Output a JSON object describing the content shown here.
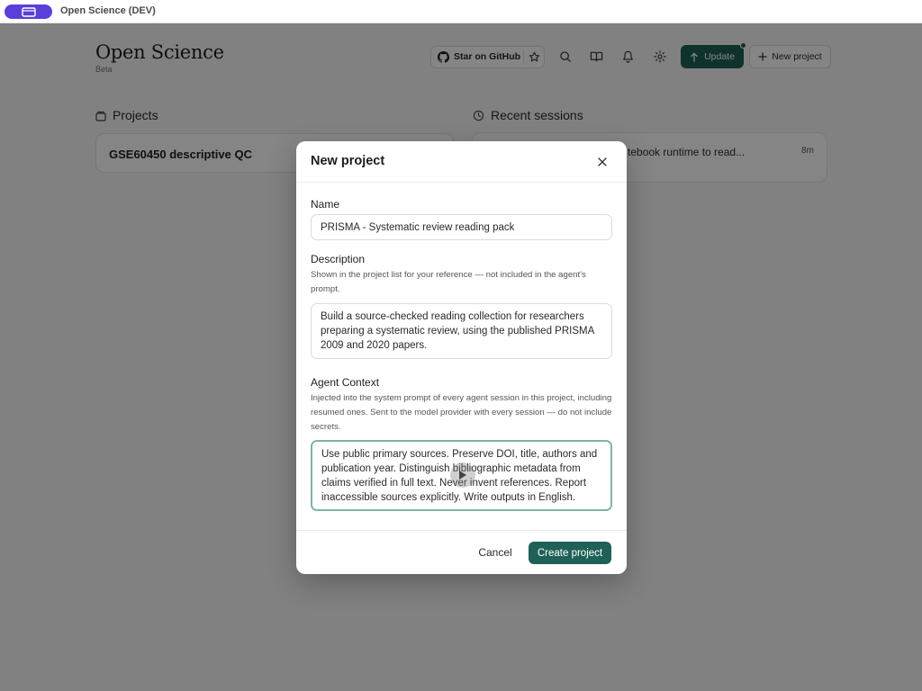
{
  "titlebar": {
    "title": "Open Science (DEV)",
    "app_icon": "window-icon",
    "accent": "#5b3fd9"
  },
  "header": {
    "brand": "Open Science",
    "tag": "Beta",
    "github_label": "Star on GitHub",
    "update_label": "Update",
    "new_project_label": "New project",
    "icons": [
      "github-icon",
      "star-icon",
      "search-icon",
      "book-icon",
      "bell-icon",
      "gear-icon",
      "arrow-up-icon",
      "plus-icon"
    ]
  },
  "projects": {
    "heading": "Projects",
    "items": [
      {
        "name": "GSE60450 descriptive QC"
      }
    ]
  },
  "sessions": {
    "heading": "Recent sessions",
    "items": [
      {
        "text": "tebook runtime to read...",
        "age": "8m"
      }
    ]
  },
  "modal": {
    "title": "New project",
    "name_label": "Name",
    "name_value": "PRISMA - Systematic review reading pack",
    "description_label": "Description",
    "description_help": "Shown in the project list for your reference — not included in the agent's prompt.",
    "description_value": "Build a source-checked reading collection for researchers preparing a systematic review, using the published PRISMA 2009 and 2020 papers.",
    "context_label": "Agent Context",
    "context_help": "Injected into the system prompt of every agent session in this project, including resumed ones. Sent to the model provider with every session — do not include secrets.",
    "context_value": "Use public primary sources. Preserve DOI, title, authors and publication year. Distinguish bibliographic metadata from claims verified in full text. Never invent references. Report inaccessible sources explicitly. Write outputs in English.",
    "cancel_label": "Cancel",
    "create_label": "Create project"
  },
  "colors": {
    "primary": "#1f6156",
    "focus_ring": "#7fb3a8"
  }
}
